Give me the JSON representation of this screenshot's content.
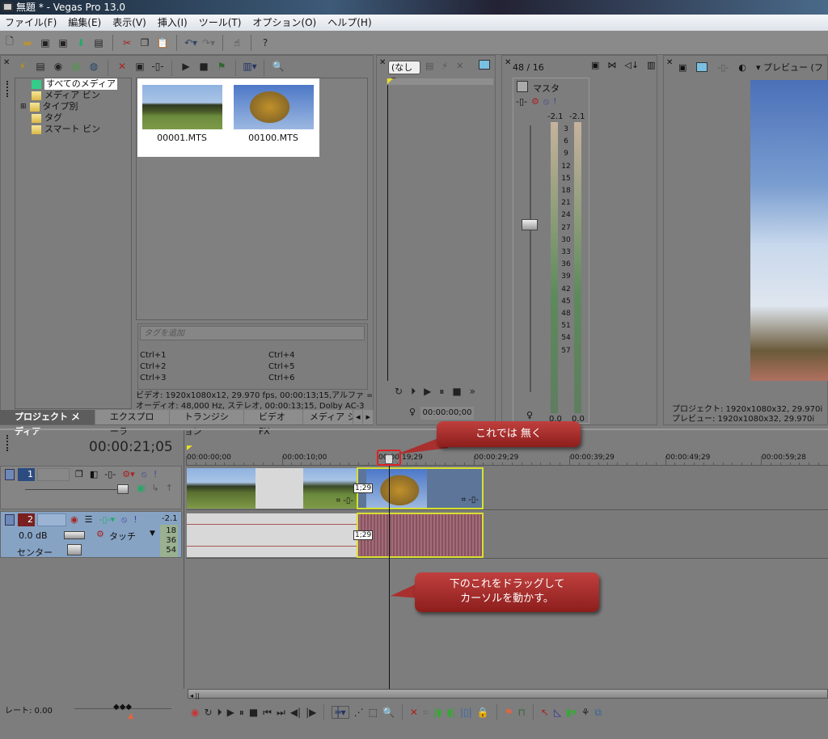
{
  "window": {
    "title": "無題 * - Vegas Pro 13.0"
  },
  "menu": [
    "ファイル(F)",
    "編集(E)",
    "表示(V)",
    "挿入(I)",
    "ツール(T)",
    "オプション(O)",
    "ヘルプ(H)"
  ],
  "explorer": {
    "tree": [
      "すべてのメディア",
      "メディア ビン",
      "タイプ別",
      "タグ",
      "スマート ビン"
    ],
    "media": [
      {
        "name": "00001.MTS"
      },
      {
        "name": "00100.MTS"
      }
    ],
    "tag_placeholder": "タグを追加",
    "shortcuts": [
      "Ctrl+1",
      "Ctrl+2",
      "Ctrl+3",
      "Ctrl+4",
      "Ctrl+5",
      "Ctrl+6"
    ],
    "info_video": "ビデオ: 1920x1080x12, 29.970 fps, 00:00:13;15,アルファ = なし",
    "info_audio": "オーディオ: 48,000 Hz, ステレオ, 00:00:13;15, Dolby AC-3",
    "tabs": [
      "プロジェクト メディア",
      "エクスプローラ",
      "トランジション",
      "ビデオ FX",
      "メディア ジェネレータ"
    ]
  },
  "trimmer": {
    "dropdown": "(なし",
    "time": "00:00:00;00"
  },
  "mixer": {
    "channels": "48 / 16",
    "master": "マスタ",
    "peak_l": "-2.1",
    "peak_r": "-2.1",
    "scale": [
      "3",
      "6",
      "9",
      "12",
      "15",
      "18",
      "21",
      "24",
      "27",
      "30",
      "33",
      "36",
      "39",
      "42",
      "45",
      "48",
      "51",
      "54",
      "57"
    ],
    "level_l": "0.0",
    "level_r": "0.0"
  },
  "preview": {
    "label": "プレビュー (フ",
    "project_info": "プロジェクト:  1920x1080x32, 29.970i",
    "preview_info": "プレビュー:    1920x1080x32, 29.970i"
  },
  "timeline": {
    "cursor_time": "00:00:21;05",
    "ruler": [
      "00:00:00;00",
      "00:00:10;00",
      "00:00:19;29",
      "00:00:29;29",
      "00:00:39;29",
      "00:00:49;29",
      "00:00:59;28"
    ],
    "video_track": {
      "number": "1",
      "fade_label": "1;29"
    },
    "audio_track": {
      "number": "2",
      "peak": "-2.1",
      "volume": "0.0 dB",
      "mode": "タッチ",
      "pan": "センター",
      "meter": [
        "18",
        "36",
        "54"
      ],
      "fade_label": "1;29"
    },
    "rate": "レート: 0.00"
  },
  "callouts": {
    "top": "これでは 無く",
    "bottom_line1": "下のこれをドラッグして",
    "bottom_line2": "カーソルを動かす。"
  },
  "colors": {
    "callout": "#a8302e",
    "selection": "#d8e030",
    "audio_clip": "#7a4650",
    "video_clip": "#5d7598"
  }
}
